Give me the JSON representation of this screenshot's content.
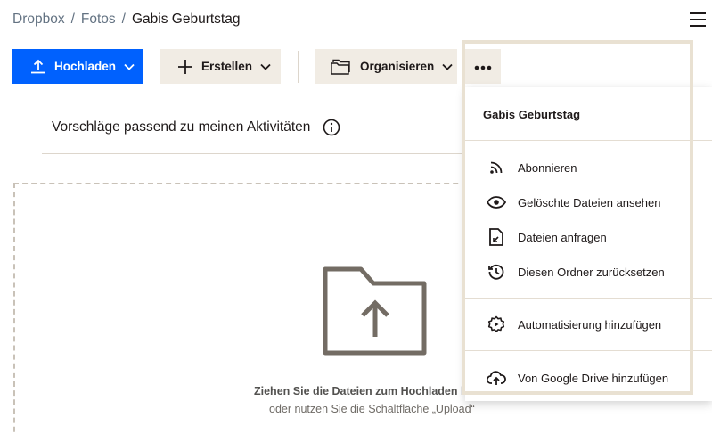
{
  "breadcrumb": {
    "root": "Dropbox",
    "parent": "Fotos",
    "current": "Gabis Geburtstag",
    "separator": "/"
  },
  "toolbar": {
    "upload_label": "Hochladen",
    "create_label": "Erstellen",
    "organize_label": "Organisieren"
  },
  "suggestions": {
    "label": "Vorschläge passend zu meinen Aktivitäten"
  },
  "dropzone": {
    "line1": "Ziehen Sie die Dateien zum Hochladen h",
    "line2": "oder nutzen Sie die Schaltfläche „Upload“"
  },
  "more_menu": {
    "title": "Gabis Geburtstag",
    "items": [
      {
        "label": "Abonnieren",
        "icon": "rss-icon"
      },
      {
        "label": "Gelöschte Dateien ansehen",
        "icon": "eye-icon"
      },
      {
        "label": "Dateien anfragen",
        "icon": "file-request-icon"
      },
      {
        "label": "Diesen Ordner zurücksetzen",
        "icon": "history-icon"
      },
      {
        "label": "Automatisierung hinzufügen",
        "icon": "automation-gear-icon"
      },
      {
        "label": "Von Google Drive hinzufügen",
        "icon": "cloud-upload-icon"
      }
    ]
  },
  "colors": {
    "primary": "#0061fe",
    "secondary_bg": "#f1ece4",
    "highlight_border": "#e9e1d2",
    "text": "#1e1919",
    "muted": "#637282",
    "folder_icon": "#736c64"
  }
}
